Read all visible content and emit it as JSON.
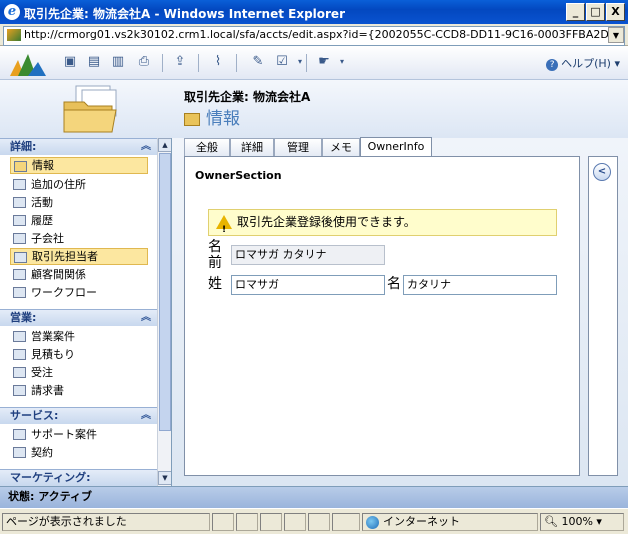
{
  "window": {
    "title": "取引先企業: 物流会社A - Windows Internet Explorer",
    "minimize_label": "_",
    "maximize_label": "□",
    "close_label": "X"
  },
  "address": {
    "url": "http://crmorg01.vs2k30102.crm1.local/sfa/accts/edit.aspx?id={2002055C-CCD8-DD11-9C16-0003FFBA2D57}#"
  },
  "toolbar": {
    "help_label": "ヘルプ(H)"
  },
  "header": {
    "record_title": "取引先企業: 物流会社A",
    "subtitle": "情報"
  },
  "nav": {
    "sections": [
      {
        "label": "詳細:",
        "items": [
          "情報",
          "追加の住所",
          "活動",
          "履歴",
          "子会社",
          "取引先担当者",
          "顧客間関係",
          "ワークフロー"
        ]
      },
      {
        "label": "営業:",
        "items": [
          "営業案件",
          "見積もり",
          "受注",
          "請求書"
        ]
      },
      {
        "label": "サービス:",
        "items": [
          "サポート案件",
          "契約"
        ]
      },
      {
        "label": "マーケティング:",
        "items": []
      }
    ]
  },
  "tabs": [
    "全般",
    "詳細",
    "管理",
    "メモ",
    "OwnerInfo"
  ],
  "form": {
    "section_title": "OwnerSection",
    "notice": "取引先企業登録後使用できます。",
    "fullname_label_1": "名",
    "fullname_label_2": "前",
    "fullname_value": "ロマサガ カタリナ",
    "lastname_label": "姓",
    "lastname_value": "ロマサガ",
    "firstname_label": "名",
    "firstname_value": "カタリナ"
  },
  "status": {
    "record_status": "状態: アクティブ"
  },
  "browser_status": {
    "message": "ページが表示されました",
    "zone": "インターネット",
    "zoom": "100%"
  },
  "colors": {
    "accent": "#4A7EBB",
    "selected_nav": "#FCE7A0",
    "notice_bg": "#FFFDCC"
  }
}
